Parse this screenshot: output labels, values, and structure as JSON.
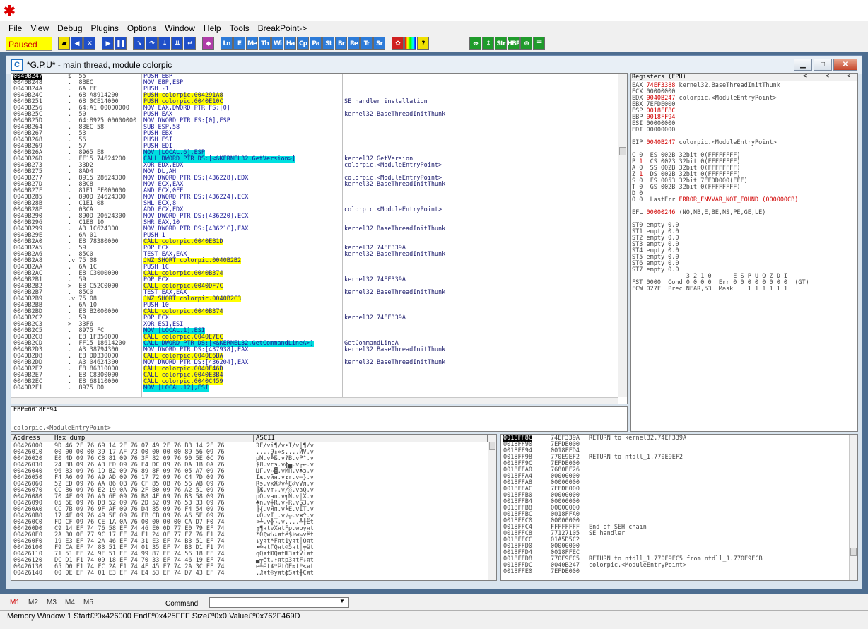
{
  "menu": [
    "File",
    "View",
    "Debug",
    "Plugins",
    "Options",
    "Window",
    "Help",
    "Tools",
    "BreakPoint->"
  ],
  "toolbar": {
    "status": "Paused",
    "g2": [
      "Ln",
      "E",
      "Me",
      "Th",
      "Wi",
      "Ha",
      "Cp",
      "Pa",
      "St",
      "Br",
      "Re",
      "Tr",
      "Sr"
    ],
    "g3": [
      "Str",
      "HBP"
    ],
    "help": "?"
  },
  "child_window": {
    "title": "*G.P.U* - main thread, module colorpic",
    "icon": "C"
  },
  "cpu": {
    "rows": [
      {
        "addr": "0040B247",
        "hex": "$  55",
        "dis": "PUSH EBP",
        "cmt": "",
        "hl": "",
        "sel": true
      },
      {
        "addr": "0040B248",
        "hex": ".  8BEC",
        "dis": "MOV EBP,ESP",
        "cmt": "",
        "hl": ""
      },
      {
        "addr": "0040B24A",
        "hex": ".  6A FF",
        "dis": "PUSH -1",
        "cmt": "",
        "hl": ""
      },
      {
        "addr": "0040B24C",
        "hex": ".  68 A8914200",
        "dis": "PUSH colorpic.004291A8",
        "cmt": "",
        "hl": "y"
      },
      {
        "addr": "0040B251",
        "hex": ".  68 0CE14000",
        "dis": "PUSH colorpic.0040E10C",
        "cmt": "SE handler installation",
        "hl": "y"
      },
      {
        "addr": "0040B256",
        "hex": ".  64:A1 00000000",
        "dis": "MOV EAX,DWORD PTR FS:[0]",
        "cmt": "",
        "hl": ""
      },
      {
        "addr": "0040B25C",
        "hex": ".  50",
        "dis": "PUSH EAX",
        "cmt": "kernel32.BaseThreadInitThunk",
        "hl": ""
      },
      {
        "addr": "0040B25D",
        "hex": ".  64:8925 00000000",
        "dis": "MOV DWORD PTR FS:[0],ESP",
        "cmt": "",
        "hl": ""
      },
      {
        "addr": "0040B264",
        "hex": ".  83EC 58",
        "dis": "SUB ESP,58",
        "cmt": "",
        "hl": ""
      },
      {
        "addr": "0040B267",
        "hex": ".  53",
        "dis": "PUSH EBX",
        "cmt": "",
        "hl": ""
      },
      {
        "addr": "0040B268",
        "hex": ".  56",
        "dis": "PUSH ESI",
        "cmt": "",
        "hl": ""
      },
      {
        "addr": "0040B269",
        "hex": ".  57",
        "dis": "PUSH EDI",
        "cmt": "",
        "hl": ""
      },
      {
        "addr": "0040B26A",
        "hex": ".  8965 E8",
        "dis": "MOV [LOCAL.6],ESP",
        "cmt": "",
        "hl": "c"
      },
      {
        "addr": "0040B26D",
        "hex": ".  FF15 74624200",
        "dis": "CALL DWORD PTR DS:[<&KERNEL32.GetVersion>]",
        "cmt": "kernel32.GetVersion",
        "hl": "c"
      },
      {
        "addr": "0040B273",
        "hex": ".  33D2",
        "dis": "XOR EDX,EDX",
        "cmt": "colorpic.<ModuleEntryPoint>",
        "hl": ""
      },
      {
        "addr": "0040B275",
        "hex": ".  8AD4",
        "dis": "MOV DL,AH",
        "cmt": "",
        "hl": ""
      },
      {
        "addr": "0040B277",
        "hex": ".  8915 28624300",
        "dis": "MOV DWORD PTR DS:[436228],EDX",
        "cmt": "colorpic.<ModuleEntryPoint>",
        "hl": ""
      },
      {
        "addr": "0040B27D",
        "hex": ".  8BC8",
        "dis": "MOV ECX,EAX",
        "cmt": "kernel32.BaseThreadInitThunk",
        "hl": ""
      },
      {
        "addr": "0040B27F",
        "hex": ".  81E1 FF000000",
        "dis": "AND ECX,0FF",
        "cmt": "",
        "hl": ""
      },
      {
        "addr": "0040B285",
        "hex": ".  890D 24624300",
        "dis": "MOV DWORD PTR DS:[436224],ECX",
        "cmt": "",
        "hl": ""
      },
      {
        "addr": "0040B28B",
        "hex": ".  C1E1 08",
        "dis": "SHL ECX,8",
        "cmt": "",
        "hl": ""
      },
      {
        "addr": "0040B28E",
        "hex": ".  03CA",
        "dis": "ADD ECX,EDX",
        "cmt": "colorpic.<ModuleEntryPoint>",
        "hl": ""
      },
      {
        "addr": "0040B290",
        "hex": ".  890D 20624300",
        "dis": "MOV DWORD PTR DS:[436220],ECX",
        "cmt": "",
        "hl": ""
      },
      {
        "addr": "0040B296",
        "hex": ".  C1E8 10",
        "dis": "SHR EAX,10",
        "cmt": "",
        "hl": ""
      },
      {
        "addr": "0040B299",
        "hex": ".  A3 1C624300",
        "dis": "MOV DWORD PTR DS:[43621C],EAX",
        "cmt": "kernel32.BaseThreadInitThunk",
        "hl": ""
      },
      {
        "addr": "0040B29E",
        "hex": ".  6A 01",
        "dis": "PUSH 1",
        "cmt": "",
        "hl": ""
      },
      {
        "addr": "0040B2A0",
        "hex": ".  E8 78380000",
        "dis": "CALL colorpic.0040EB1D",
        "cmt": "",
        "hl": "y"
      },
      {
        "addr": "0040B2A5",
        "hex": ".  59",
        "dis": "POP ECX",
        "cmt": "kernel32.74EF339A",
        "hl": ""
      },
      {
        "addr": "0040B2A6",
        "hex": ".  85C0",
        "dis": "TEST EAX,EAX",
        "cmt": "kernel32.BaseThreadInitThunk",
        "hl": ""
      },
      {
        "addr": "0040B2A8",
        "hex": ".v 75 08",
        "dis": "JNZ SHORT colorpic.0040B2B2",
        "cmt": "",
        "hl": "y"
      },
      {
        "addr": "0040B2AA",
        "hex": ".  6A 1C",
        "dis": "PUSH 1C",
        "cmt": "",
        "hl": ""
      },
      {
        "addr": "0040B2AC",
        "hex": ".  E8 C3000000",
        "dis": "CALL colorpic.0040B374",
        "cmt": "",
        "hl": "y"
      },
      {
        "addr": "0040B2B1",
        "hex": ".  59",
        "dis": "POP ECX",
        "cmt": "kernel32.74EF339A",
        "hl": ""
      },
      {
        "addr": "0040B2B2",
        "hex": ">  E8 C52C0000",
        "dis": "CALL colorpic.0040DF7C",
        "cmt": "",
        "hl": "y"
      },
      {
        "addr": "0040B2B7",
        "hex": ".  85C0",
        "dis": "TEST EAX,EAX",
        "cmt": "kernel32.BaseThreadInitThunk",
        "hl": ""
      },
      {
        "addr": "0040B2B9",
        "hex": ".v 75 08",
        "dis": "JNZ SHORT colorpic.0040B2C3",
        "cmt": "",
        "hl": "y"
      },
      {
        "addr": "0040B2BB",
        "hex": ".  6A 10",
        "dis": "PUSH 10",
        "cmt": "",
        "hl": ""
      },
      {
        "addr": "0040B2BD",
        "hex": ".  E8 B2000000",
        "dis": "CALL colorpic.0040B374",
        "cmt": "",
        "hl": "y"
      },
      {
        "addr": "0040B2C2",
        "hex": ".  59",
        "dis": "POP ECX",
        "cmt": "kernel32.74EF339A",
        "hl": ""
      },
      {
        "addr": "0040B2C3",
        "hex": ">  33F6",
        "dis": "XOR ESI,ESI",
        "cmt": "",
        "hl": ""
      },
      {
        "addr": "0040B2C5",
        "hex": ".  8975 FC",
        "dis": "MOV [LOCAL.1],ESI",
        "cmt": "",
        "hl": "c"
      },
      {
        "addr": "0040B2C8",
        "hex": ".  E8 1F350000",
        "dis": "CALL colorpic.0040E7EC",
        "cmt": "",
        "hl": "y"
      },
      {
        "addr": "0040B2CD",
        "hex": ".  FF15 18614200",
        "dis": "CALL DWORD PTR DS:[<&KERNEL32.GetCommandLineA>]",
        "cmt": "GetCommandLineA",
        "hl": "c"
      },
      {
        "addr": "0040B2D3",
        "hex": ".  A3 38794300",
        "dis": "MOV DWORD PTR DS:[437938],EAX",
        "cmt": "kernel32.BaseThreadInitThunk",
        "hl": ""
      },
      {
        "addr": "0040B2D8",
        "hex": ".  E8 DD330000",
        "dis": "CALL colorpic.0040E6BA",
        "cmt": "",
        "hl": "y"
      },
      {
        "addr": "0040B2DD",
        "hex": ".  A3 04624300",
        "dis": "MOV DWORD PTR DS:[436204],EAX",
        "cmt": "kernel32.BaseThreadInitThunk",
        "hl": ""
      },
      {
        "addr": "0040B2E2",
        "hex": ".  E8 86310000",
        "dis": "CALL colorpic.0040E46D",
        "cmt": "",
        "hl": "y"
      },
      {
        "addr": "0040B2E7",
        "hex": ".  E8 C8300000",
        "dis": "CALL colorpic.0040E3B4",
        "cmt": "",
        "hl": "y"
      },
      {
        "addr": "0040B2EC",
        "hex": ".  E8 68110000",
        "dis": "CALL colorpic.0040C459",
        "cmt": "",
        "hl": "y"
      },
      {
        "addr": "0040B2F1",
        "hex": ".  8975 D0",
        "dis": "MOV [LOCAL.12],ESI",
        "cmt": "",
        "hl": "c"
      }
    ]
  },
  "info": {
    "line1": "EBP=0018FF94",
    "line2": "colorpic.<ModuleEntryPoint>"
  },
  "registers": {
    "title": "Registers (FPU)",
    "lines": [
      {
        "t": "EAX 74EF3388 kernel32.BaseThreadInitThunk",
        "red": "74EF3388"
      },
      {
        "t": "ECX 00000000"
      },
      {
        "t": "EDX 0040B247 colorpic.<ModuleEntryPoint>",
        "red": "0040B247"
      },
      {
        "t": "EBX 7EFDE000"
      },
      {
        "t": "ESP 0018FF8C",
        "red": "0018FF8C"
      },
      {
        "t": "EBP 0018FF94",
        "red": "0018FF94"
      },
      {
        "t": "ESI 00000000"
      },
      {
        "t": "EDI 00000000"
      },
      {
        "t": ""
      },
      {
        "t": "EIP 0040B247 colorpic.<ModuleEntryPoint>",
        "red": "0040B247"
      },
      {
        "t": ""
      },
      {
        "t": "C 0  ES 002B 32bit 0(FFFFFFFF)"
      },
      {
        "t": "P 1  CS 0023 32bit 0(FFFFFFFF)",
        "red": "1"
      },
      {
        "t": "A 0  SS 002B 32bit 0(FFFFFFFF)"
      },
      {
        "t": "Z 1  DS 002B 32bit 0(FFFFFFFF)",
        "red": "1"
      },
      {
        "t": "S 0  FS 0053 32bit 7EFDD000(FFF)"
      },
      {
        "t": "T 0  GS 002B 32bit 0(FFFFFFFF)"
      },
      {
        "t": "D 0"
      },
      {
        "t": "O 0  LastErr ERROR_ENVVAR_NOT_FOUND (000000CB)",
        "red": "ERROR_ENVVAR_NOT_FOUND (000000CB)"
      },
      {
        "t": ""
      },
      {
        "t": "EFL 00000246 (NO,NB,E,BE,NS,PE,GE,LE)",
        "red": "00000246"
      },
      {
        "t": ""
      },
      {
        "t": "ST0 empty 0.0"
      },
      {
        "t": "ST1 empty 0.0"
      },
      {
        "t": "ST2 empty 0.0"
      },
      {
        "t": "ST3 empty 0.0"
      },
      {
        "t": "ST4 empty 0.0"
      },
      {
        "t": "ST5 empty 0.0"
      },
      {
        "t": "ST6 empty 0.0"
      },
      {
        "t": "ST7 empty 0.0"
      },
      {
        "t": "               3 2 1 0      E S P U O Z D I"
      },
      {
        "t": "FST 0000  Cond 0 0 0 0  Err 0 0 0 0 0 0 0 0  (GT)"
      },
      {
        "t": "FCW 027F  Prec NEAR,53  Mask    1 1 1 1 1 1"
      }
    ]
  },
  "dump": {
    "headers": [
      "Address",
      "Hex dump",
      "ASCII"
    ],
    "rows": [
      {
        "a": "00426000",
        "h": "9D 46 2F 76 69 14 2F 76 07 49 2F 76 B3 14 2F 76",
        "s": "ЭF/vi¶/v•I/v│¶/v"
      },
      {
        "a": "00426010",
        "h": "00 00 00 00 39 17 AF 73 00 00 00 00 89 56 09 76",
        "s": "....9↨»s....ЙV.v"
      },
      {
        "a": "00426020",
        "h": "E0 4D 09 76 C8 81 09 76 3F 82 09 76 90 5E 0C 76",
        "s": "рM.v╚Б.v?В.vР^.v"
      },
      {
        "a": "00426030",
        "h": "24 8B 09 76 A3 ED 09 76 E4 DC 09 76 DA 1B 0A 76",
        "s": "$Л.vгэ.vф▄.v┌←.v"
      },
      {
        "a": "00426040",
        "h": "96 83 09 76 1D B2 09 76 89 8F 09 76 05 A7 09 76",
        "s": "ЦГ.v↔▓.vЙП.v♣з.v"
      },
      {
        "a": "00426050",
        "h": "F4 A6 09 76 A9 AD 09 76 17 72 09 76 C4 7D 09 76",
        "s": "Їж.vйн.v↨r.v─}.v"
      },
      {
        "a": "00426060",
        "h": "52 ED 09 76 AA 86 0B 76 CF 85 0B 76 56 AB 09 76",
        "s": "Rэ.vкЖ♂v╧Е♂vVл.v"
      },
      {
        "a": "00426070",
        "h": "CC 86 09 76 E2 19 0A 76 2F B0 09 76 A2 51 09 76",
        "s": "╠Ж.vт↓.v/░.vвQ.v"
      },
      {
        "a": "00426080",
        "h": "70 4F 09 76 A0 6E 09 76 B8 4E 09 76 B3 58 09 76",
        "s": "pO.vаn.v╕N.v│X.v"
      },
      {
        "a": "00426090",
        "h": "05 6E 09 76 D8 52 09 76 2D 52 09 76 53 33 09 76",
        "s": "♣n.v╪R.v-R.vS3.v"
      },
      {
        "a": "004260A0",
        "h": "CC 7B 09 76 9F AF 09 76 D4 85 09 76 F4 54 09 76",
        "s": "╠{.vЯп.v╘Е.vЇT.v"
      },
      {
        "a": "004260B0",
        "h": "17 4F 09 76 49 5F 09 76 FB CB 09 76 A6 5E 09 76",
        "s": "↨O.vI_.v√╦.vж^.v"
      },
      {
        "a": "004260C0",
        "h": "FD CF 09 76 CE 1A 0A 76 00 00 00 00 CA D7 F0 74",
        "s": "¤╧.v╬→.v....╩╫Ёt"
      },
      {
        "a": "004260D0",
        "h": "C9 14 EF 74 76 58 EF 74 46 E0 0D 77 E0 79 EF 74",
        "s": "╔¶яtvXяtFр.wрyяt"
      },
      {
        "a": "004260E0",
        "h": "2A 30 0E 77 9C 17 EF 74 F1 24 0F 77 F7 76 F1 74",
        "s": "*0♫wЬ↨яtё$☼w≈vёt"
      },
      {
        "a": "004260F0",
        "h": "19 E3 EF 74 2A 46 EF 74 31 E3 EF 74 B3 51 EF 74",
        "s": "↓уяt*Fяt1уяt│Qяt"
      },
      {
        "a": "00426100",
        "h": "F9 CA EF 74 83 51 EF 74 01 35 EF 74 B3 D1 F1 74",
        "s": "∙╩яtГQяt☺5яt│╤ёt"
      },
      {
        "a": "00426110",
        "h": "71 51 EF 74 9E 51 EF 74 99 87 EF 74 56 18 EF 74",
        "s": "qQяtЮQяtЩЗяtV↑яt"
      },
      {
        "a": "00426120",
        "h": "DC D1 F1 74 09 18 EF 74 70 33 EF 74 46 19 EF 74",
        "s": "▄╤ёt.↑яtp3яtF↓яt"
      },
      {
        "a": "00426130",
        "h": "65 D0 F1 74 FC 2A F1 74 4F 45 F7 74 2A 3C EF 74",
        "s": "e╨ёt№*ёtOE≈t*<яt"
      },
      {
        "a": "00426140",
        "h": "00 0E EF 74 01 E3 EF 74 E4 53 EF 74 D7 43 EF 74",
        "s": ".♫яt☺уяtфSяt╫Cяt"
      }
    ]
  },
  "stack": {
    "rows": [
      {
        "a": "0018FF8C",
        "v": "74EF339A",
        "c": "RETURN to kernel32.74EF339A",
        "sel": true
      },
      {
        "a": "0018FF90",
        "v": "7EFDE000",
        "c": ""
      },
      {
        "a": "0018FF94",
        "v": "0018FFD4",
        "c": ""
      },
      {
        "a": "0018FF98",
        "v": "770E9EF2",
        "c": "RETURN to ntdll_1.770E9EF2"
      },
      {
        "a": "0018FF9C",
        "v": "7EFDE000",
        "c": ""
      },
      {
        "a": "0018FFA0",
        "v": "7680EF26",
        "c": ""
      },
      {
        "a": "0018FFA4",
        "v": "00000000",
        "c": ""
      },
      {
        "a": "0018FFA8",
        "v": "00000000",
        "c": ""
      },
      {
        "a": "0018FFAC",
        "v": "7EFDE000",
        "c": ""
      },
      {
        "a": "0018FFB0",
        "v": "00000000",
        "c": ""
      },
      {
        "a": "0018FFB4",
        "v": "00000000",
        "c": ""
      },
      {
        "a": "0018FFB8",
        "v": "00000000",
        "c": ""
      },
      {
        "a": "0018FFBC",
        "v": "0018FFA0",
        "c": ""
      },
      {
        "a": "0018FFC0",
        "v": "00000000",
        "c": ""
      },
      {
        "a": "0018FFC4",
        "v": "FFFFFFFF",
        "c": "End of SEH chain"
      },
      {
        "a": "0018FFC8",
        "v": "77127105",
        "c": "SE handler"
      },
      {
        "a": "0018FFCC",
        "v": "01A5D5C2",
        "c": ""
      },
      {
        "a": "0018FFD0",
        "v": "00000000",
        "c": ""
      },
      {
        "a": "0018FFD4",
        "v": "0018FFEC",
        "c": ""
      },
      {
        "a": "0018FFD8",
        "v": "770E9EC5",
        "c": "RETURN to ntdll_1.770E9EC5 from ntdll_1.770E9ECB"
      },
      {
        "a": "0018FFDC",
        "v": "0040B247",
        "c": "colorpic.<ModuleEntryPoint>"
      },
      {
        "a": "0018FFE0",
        "v": "7EFDE000",
        "c": ""
      }
    ]
  },
  "bottom": {
    "tabs": [
      "M1",
      "M2",
      "M3",
      "M4",
      "M5"
    ],
    "command_label": "Command:",
    "status": "Memory Window 1  Start£º0x426000  End£º0x425FFF  Size£º0x0 Value£º0x762F469D"
  }
}
